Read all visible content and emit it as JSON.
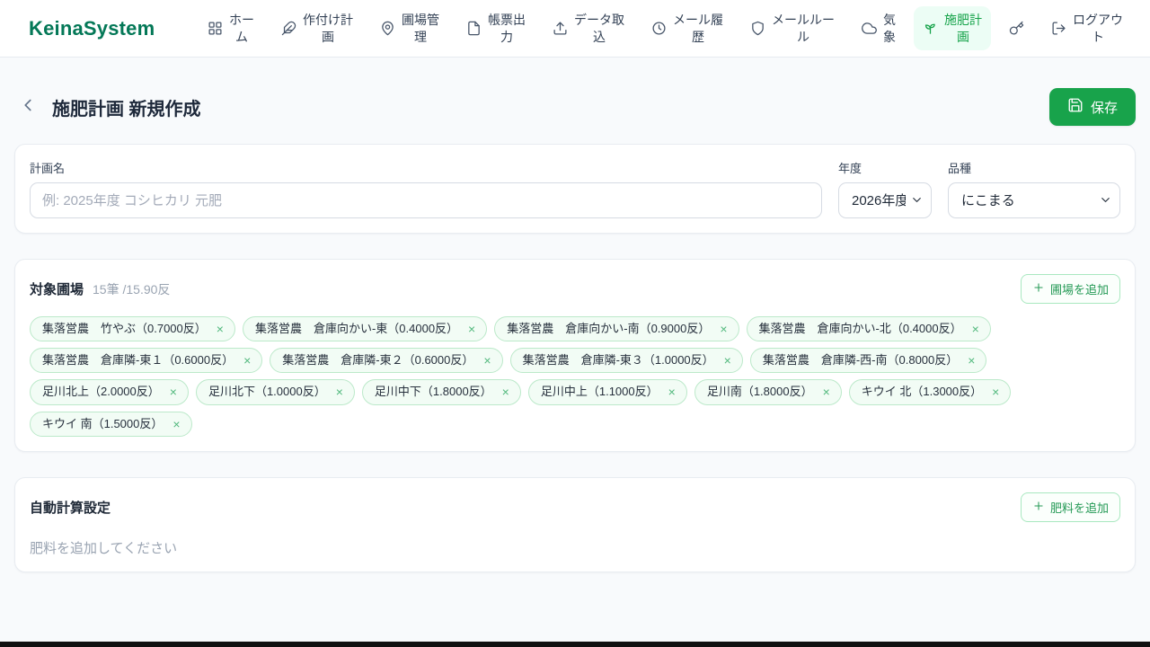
{
  "app": {
    "name": "KeinaSystem"
  },
  "nav": {
    "items": [
      {
        "name": "home",
        "label": "ホーム",
        "icon": "grid-icon",
        "active": false
      },
      {
        "name": "planting-plan",
        "label": "作付け計画",
        "icon": "wheat-icon",
        "active": false
      },
      {
        "name": "field-management",
        "label": "圃場管理",
        "icon": "map-pin-icon",
        "active": false
      },
      {
        "name": "report-output",
        "label": "帳票出力",
        "icon": "document-icon",
        "active": false
      },
      {
        "name": "data-import",
        "label": "データ取込",
        "icon": "upload-icon",
        "active": false
      },
      {
        "name": "mail-history",
        "label": "メール履歴",
        "icon": "history-icon",
        "active": false
      },
      {
        "name": "mail-rules",
        "label": "メールルール",
        "icon": "shield-icon",
        "active": false
      },
      {
        "name": "weather",
        "label": "気象",
        "icon": "cloud-icon",
        "active": false
      },
      {
        "name": "fertilization-plan",
        "label": "施肥計画",
        "icon": "sprout-icon",
        "active": true
      },
      {
        "name": "key",
        "label": "",
        "icon": "key-icon",
        "active": false
      },
      {
        "name": "logout",
        "label": "ログアウト",
        "icon": "logout-icon",
        "active": false
      }
    ]
  },
  "header": {
    "title": "施肥計画 新規作成",
    "save_label": "保存"
  },
  "plan_form": {
    "name_label": "計画名",
    "name_placeholder": "例: 2025年度 コシヒカリ 元肥",
    "name_value": "",
    "year_label": "年度",
    "year_value": "2026年度",
    "variety_label": "品種",
    "variety_value": "にこまる"
  },
  "fields_section": {
    "title": "対象圃場",
    "summary": "15筆 /15.90反",
    "add_button": "圃場を追加",
    "tags": [
      {
        "label": "集落営農　竹やぶ（0.7000反）"
      },
      {
        "label": "集落営農　倉庫向かい-東（0.4000反）"
      },
      {
        "label": "集落営農　倉庫向かい-南（0.9000反）"
      },
      {
        "label": "集落営農　倉庫向かい-北（0.4000反）"
      },
      {
        "label": "集落営農　倉庫隣-東１（0.6000反）"
      },
      {
        "label": "集落営農　倉庫隣-東２（0.6000反）"
      },
      {
        "label": "集落営農　倉庫隣-東３（1.0000反）"
      },
      {
        "label": "集落営農　倉庫隣-西-南（0.8000反）"
      },
      {
        "label": "足川北上（2.0000反）"
      },
      {
        "label": "足川北下（1.0000反）"
      },
      {
        "label": "足川中下（1.8000反）"
      },
      {
        "label": "足川中上（1.1000反）"
      },
      {
        "label": "足川南（1.8000反）"
      },
      {
        "label": "キウイ 北（1.3000反）"
      },
      {
        "label": "キウイ 南（1.5000反）"
      }
    ]
  },
  "auto_calc_section": {
    "title": "自動計算設定",
    "add_button": "肥料を追加",
    "empty_message": "肥料を追加してください"
  },
  "colors": {
    "accent_green": "#18a34b",
    "logo_green": "#047857",
    "active_nav_bg": "#ecfdf5",
    "tag_bg": "#f2fcf5",
    "tag_border": "#bce9ca",
    "muted_text": "#9aa4b2"
  }
}
